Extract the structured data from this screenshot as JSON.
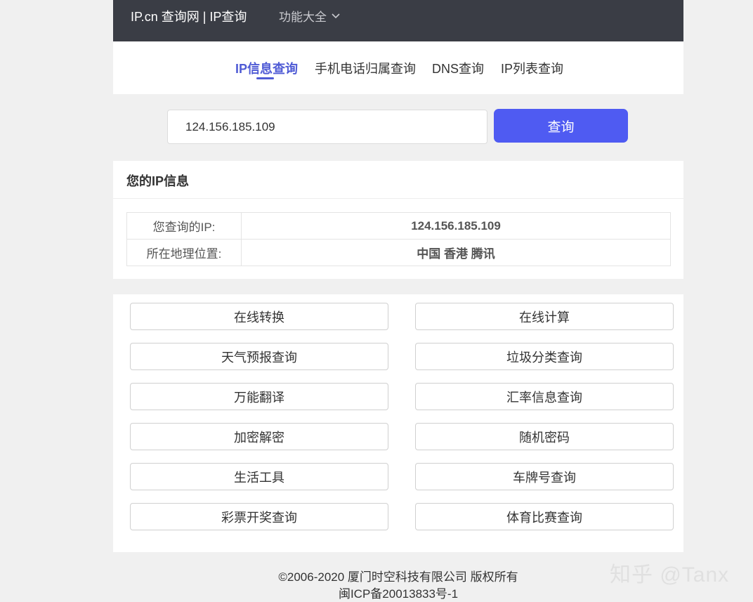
{
  "header": {
    "brand": "IP.cn 查询网 | IP查询",
    "features_label": "功能大全"
  },
  "tabs": [
    {
      "label": "IP信息查询",
      "active": true
    },
    {
      "label": "手机电话归属查询",
      "active": false
    },
    {
      "label": "DNS查询",
      "active": false
    },
    {
      "label": "IP列表查询",
      "active": false
    }
  ],
  "search": {
    "value": "124.156.185.109",
    "button_label": "查询"
  },
  "info": {
    "title": "您的IP信息",
    "rows": [
      {
        "label": "您查询的IP:",
        "value": "124.156.185.109"
      },
      {
        "label": "所在地理位置:",
        "value": "中国 香港 腾讯"
      }
    ]
  },
  "tools": [
    "在线转换",
    "在线计算",
    "天气预报查询",
    "垃圾分类查询",
    "万能翻译",
    "汇率信息查询",
    "加密解密",
    "随机密码",
    "生活工具",
    "车牌号查询",
    "彩票开奖查询",
    "体育比赛查询"
  ],
  "footer": {
    "copyright": "©2006-2020 厦门时空科技有限公司 版权所有",
    "icp": "闽ICP备20013833号-1"
  },
  "watermark": "知乎 @Tanx",
  "colors": {
    "topbar": "#3a3d45",
    "accent": "#4f5bf2",
    "page_bg": "#f0f0f0"
  }
}
